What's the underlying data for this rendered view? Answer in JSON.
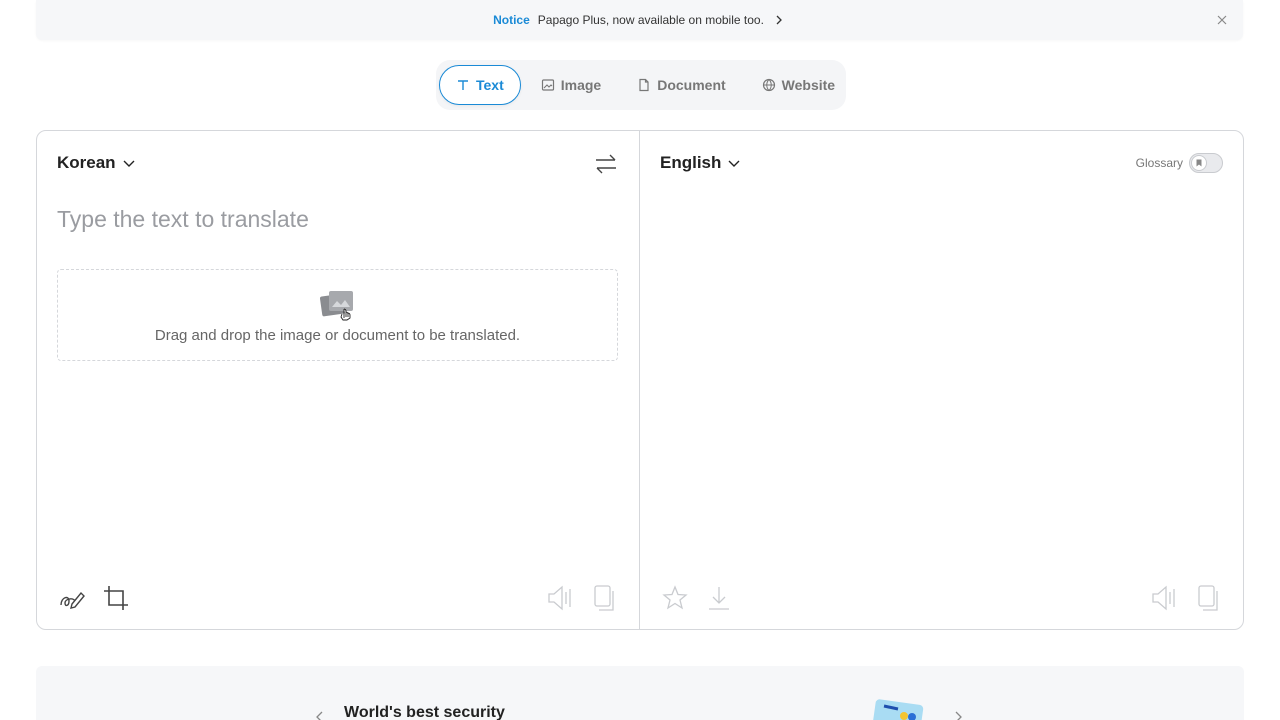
{
  "notice": {
    "tag": "Notice",
    "message": "Papago Plus, now available on mobile too."
  },
  "modes": [
    {
      "label": "Text",
      "icon": "text-icon",
      "active": true
    },
    {
      "label": "Image",
      "icon": "image-icon",
      "active": false
    },
    {
      "label": "Document",
      "icon": "document-icon",
      "active": false
    },
    {
      "label": "Website",
      "icon": "globe-icon",
      "active": false
    }
  ],
  "source": {
    "language": "Korean",
    "placeholder": "Type the text to translate",
    "value": "",
    "dropzone_text": "Drag and drop the image or document to be translated."
  },
  "target": {
    "language": "English",
    "glossary_label": "Glossary",
    "glossary_enabled": false
  },
  "banner": {
    "title": "World's best security"
  },
  "colors": {
    "accent": "#1a8ad6",
    "border": "#d5d7db",
    "muted": "#9a9ca1"
  }
}
